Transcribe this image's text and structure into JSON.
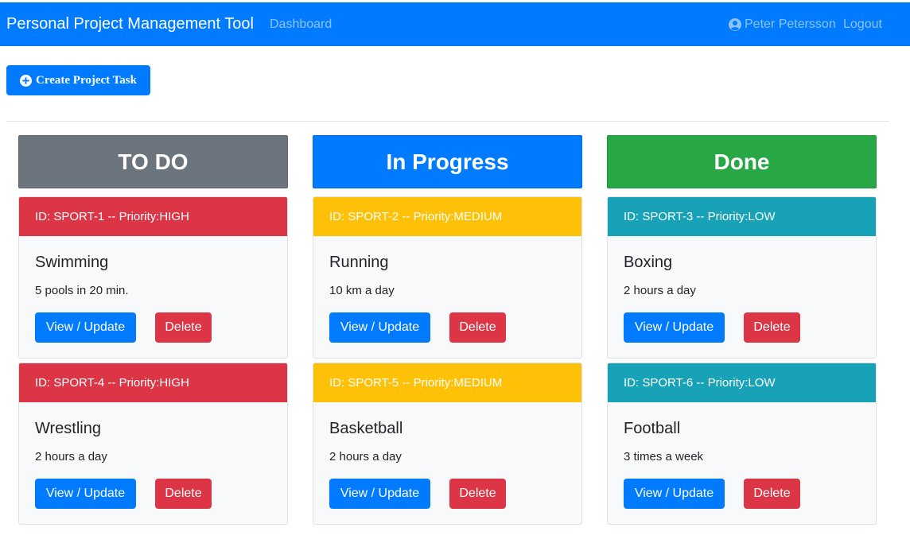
{
  "navbar": {
    "brand": "Personal Project Management Tool",
    "dashboard": "Dashboard",
    "user": "Peter Petersson",
    "logout": "Logout"
  },
  "toolbar": {
    "create_label": "Create Project Task"
  },
  "columns": [
    {
      "title": "TO DO",
      "color": "#6c757d",
      "cards": [
        {
          "header": "ID: SPORT-1 -- Priority:HIGH",
          "priority": "high",
          "title": "Swimming",
          "desc": "5 pools in 20 min.",
          "view": "View / Update",
          "delete": "Delete"
        },
        {
          "header": "ID: SPORT-4 -- Priority:HIGH",
          "priority": "high",
          "title": "Wrestling",
          "desc": "2 hours a day",
          "view": "View / Update",
          "delete": "Delete"
        }
      ]
    },
    {
      "title": "In Progress",
      "color": "#007bff",
      "cards": [
        {
          "header": "ID: SPORT-2 -- Priority:MEDIUM",
          "priority": "medium",
          "title": "Running",
          "desc": "10 km a day",
          "view": "View / Update",
          "delete": "Delete"
        },
        {
          "header": "ID: SPORT-5 -- Priority:MEDIUM",
          "priority": "medium",
          "title": "Basketball",
          "desc": "2 hours a day",
          "view": "View / Update",
          "delete": "Delete"
        }
      ]
    },
    {
      "title": "Done",
      "color": "#28a745",
      "cards": [
        {
          "header": "ID: SPORT-3 -- Priority:LOW",
          "priority": "low",
          "title": "Boxing",
          "desc": "2 hours a day",
          "view": "View / Update",
          "delete": "Delete"
        },
        {
          "header": "ID: SPORT-6 -- Priority:LOW",
          "priority": "low",
          "title": "Football",
          "desc": "3 times a week",
          "view": "View / Update",
          "delete": "Delete"
        }
      ]
    }
  ],
  "colors": {
    "primary": "#007bff",
    "danger": "#dc3545",
    "warning": "#ffc107",
    "info": "#17a2b8",
    "success": "#28a745",
    "secondary": "#6c757d"
  },
  "icons": {
    "user": "user-circle-icon",
    "create": "plus-circle-icon"
  }
}
